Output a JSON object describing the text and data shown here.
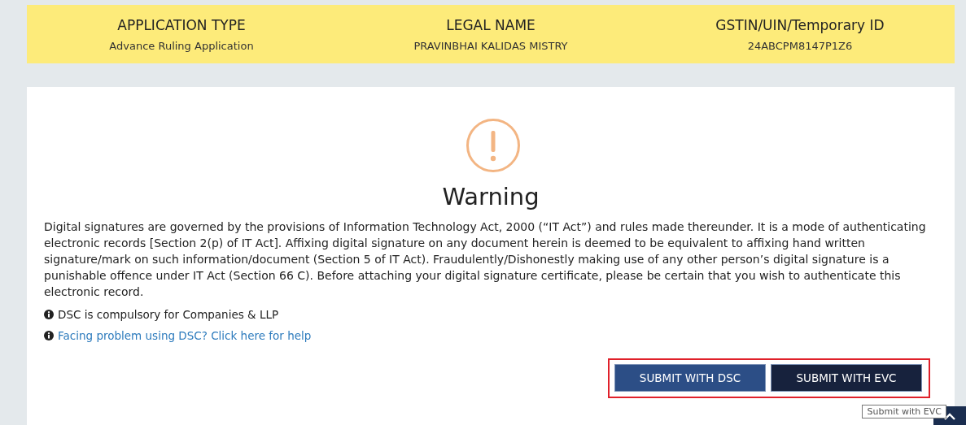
{
  "header": {
    "fields": [
      {
        "label": "APPLICATION TYPE",
        "value": "Advance Ruling Application"
      },
      {
        "label": "LEGAL NAME",
        "value": "PRAVINBHAI KALIDAS MISTRY"
      },
      {
        "label": "GSTIN/UIN/Temporary ID",
        "value": "24ABCPM8147P1Z6"
      }
    ]
  },
  "warning": {
    "title": "Warning",
    "paragraph": "Digital signatures are governed by the provisions of Information Technology Act, 2000 (“IT Act”) and rules made thereunder. It is a mode of authenticating electronic records [Section 2(p) of IT Act]. Affixing digital signature on any document herein is deemed to be equivalent to affixing hand written signature/mark on such information/document (Section 5 of IT Act). Fraudulently/Dishonestly making use of any other person’s digital signature is a punishable offence under IT Act (Section 66 C). Before attaching your digital signature certificate, please be certain that you wish to authenticate this electronic record.",
    "notes": [
      {
        "kind": "text",
        "text": "DSC is compulsory for Companies & LLP"
      },
      {
        "kind": "link",
        "text": "Facing problem using DSC? Click here for help"
      }
    ],
    "buttons_highlighted": true,
    "buttons": [
      {
        "kind": "primary",
        "label": "SUBMIT WITH DSC"
      },
      {
        "kind": "dark",
        "label": "SUBMIT WITH EVC"
      }
    ]
  },
  "tooltip": "Submit with EVC"
}
